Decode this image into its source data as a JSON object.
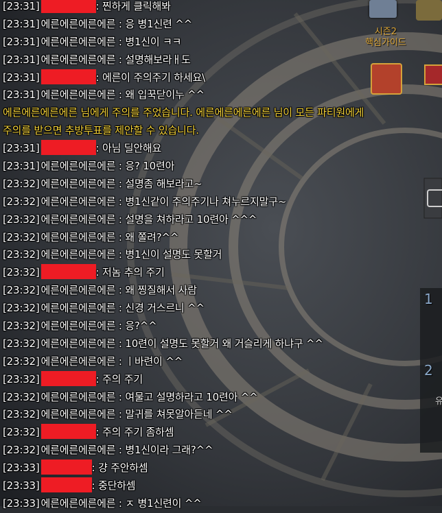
{
  "colors": {
    "system_text": "#f5d33a",
    "chat_text": "#ffffff",
    "redaction": "#ee1c24"
  },
  "sidebar": {
    "season_guide_label": "시즌2\n핵심가이드",
    "item_label_1": "1",
    "item_label_2": "2",
    "item_label_3": "유"
  },
  "chat": {
    "lines": [
      {
        "ts": "[23:31]",
        "sender": "",
        "redacted": true,
        "rw": 80,
        "msg": ": 찐하게 클릭해봐"
      },
      {
        "ts": "[23:31]",
        "sender": "에른에른에른에른",
        "msg": " : 응 병1신련 ^^"
      },
      {
        "ts": "[23:31]",
        "sender": "에른에른에른에른",
        "msg": " : 병1신이 ㅋㅋ"
      },
      {
        "ts": "[23:31]",
        "sender": "에른에른에른에른",
        "msg": " : 설명해보라ㅐ도"
      },
      {
        "ts": "[23:31]",
        "sender": "",
        "redacted": true,
        "rw": 80,
        "msg": ": 에른이 주의주기 하세요\\"
      },
      {
        "ts": "[23:31]",
        "sender": "에른에른에른에른",
        "msg": " : 왜 입꾹닫이누 ^^"
      },
      {
        "system": true,
        "msg": "에른에른에른에른 님에게 주의를 주었습니다. 에른에른에른에른 님이 모든 파티원에게"
      },
      {
        "system": true,
        "msg": "주의를 받으면 추방투표를 제안할 수 있습니다."
      },
      {
        "ts": "[23:31]",
        "sender": "",
        "redacted": true,
        "rw": 80,
        "msg": ": 아님 딜안해요"
      },
      {
        "ts": "[23:31]",
        "sender": "에른에른에른에른",
        "msg": " : 응? 10련아"
      },
      {
        "ts": "[23:32]",
        "sender": "에른에른에른에른",
        "msg": " : 설명좀 해보라고~"
      },
      {
        "ts": "[23:32]",
        "sender": "에른에른에른에른",
        "msg": " : 병1신같이 주의주기나 쳐누르지말구~"
      },
      {
        "ts": "[23:32]",
        "sender": "에른에른에른에른",
        "msg": " : 설명을 쳐하라고 10련아 ^^^"
      },
      {
        "ts": "[23:32]",
        "sender": "에른에른에른에른",
        "msg": " : 왜 쫄려?^^"
      },
      {
        "ts": "[23:32]",
        "sender": "에른에른에른에른",
        "msg": " : 병1신이 설명도 못할거"
      },
      {
        "ts": "[23:32]",
        "sender": "",
        "redacted": true,
        "rw": 80,
        "msg": ": 저놈 추의  주기"
      },
      {
        "ts": "[23:32]",
        "sender": "에른에른에른에른",
        "msg": " : 왜 찡질해서 사람"
      },
      {
        "ts": "[23:32]",
        "sender": "에른에른에른에른",
        "msg": " : 신경 거스르니 ^^"
      },
      {
        "ts": "[23:32]",
        "sender": "에른에른에른에른",
        "msg": " : 응?^^"
      },
      {
        "ts": "[23:32]",
        "sender": "에른에른에른에른",
        "msg": " : 10련이 설명도 못할거 왜 거슬리게 하냐구 ^^"
      },
      {
        "ts": "[23:32]",
        "sender": "에른에른에른에른",
        "msg": " : ㅣ바련이 ^^"
      },
      {
        "ts": "[23:32]",
        "sender": "",
        "redacted": true,
        "rw": 80,
        "msg": ": 주의 주기"
      },
      {
        "ts": "[23:32]",
        "sender": "에른에른에른에른",
        "msg": " : 여물고 설명하라고 10련아 ^^"
      },
      {
        "ts": "[23:32]",
        "sender": "에른에른에른에른",
        "msg": " : 말귀를 쳐못알아듣네 ^^"
      },
      {
        "ts": "[23:32]",
        "sender": "",
        "redacted": true,
        "rw": 80,
        "msg": ": 주의 주기 좀하셈"
      },
      {
        "ts": "[23:32]",
        "sender": "에른에른에른에른",
        "msg": " : 병1신이라 그래?^^"
      },
      {
        "ts": "[23:33]",
        "sender": "",
        "redacted": true,
        "rw": 74,
        "msg": ": 걍 주안하셈"
      },
      {
        "ts": "[23:33]",
        "sender": "",
        "redacted": true,
        "rw": 74,
        "msg": ": 중단하셈"
      },
      {
        "ts": "[23:33]",
        "sender": "에른에른에른에른",
        "msg": " : ㅈ 병1신련이 ^^"
      }
    ]
  }
}
